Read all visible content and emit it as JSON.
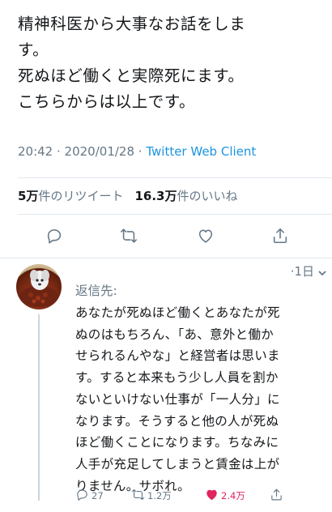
{
  "tweet": {
    "lines": [
      "精神科医から大事なお話をしま",
      "す。",
      "死ぬほど働くと実際死にます。",
      "こちらからは以上です。"
    ],
    "time": "20:42",
    "date": "2020/01/28",
    "separator": " · ",
    "client": "Twitter Web Client",
    "retweets_count": "5万",
    "retweets_label": "件のリツイート",
    "likes_count": "16.3万",
    "likes_label": "件のいいね"
  },
  "actions": {
    "reply_icon": "reply-icon",
    "retweet_icon": "retweet-icon",
    "like_icon": "heart-icon",
    "share_icon": "share-icon"
  },
  "reply": {
    "time": "·1日",
    "reply_to": "返信先:",
    "lines": [
      "あなたが死ぬほど働くとあなたが死",
      "ぬのはもちろん、「あ、意外と働か",
      "せられるんやな」と経営者は思いま",
      "す。すると本来もう少し人員を割か",
      "ないといけない仕事が「一人分」に",
      "なります。そうすると他の人が死ぬ",
      "ほど働くことになります。ちなみに",
      "人手が充足してしまうと賃金は上が",
      "りません。サボれ。"
    ],
    "reply_count": "27",
    "retweet_count": "1.2万",
    "like_count": "2.4万",
    "like_color": "#e0245e"
  },
  "colors": {
    "link": "#1b95e0",
    "muted": "#657786",
    "text": "#14171a"
  }
}
